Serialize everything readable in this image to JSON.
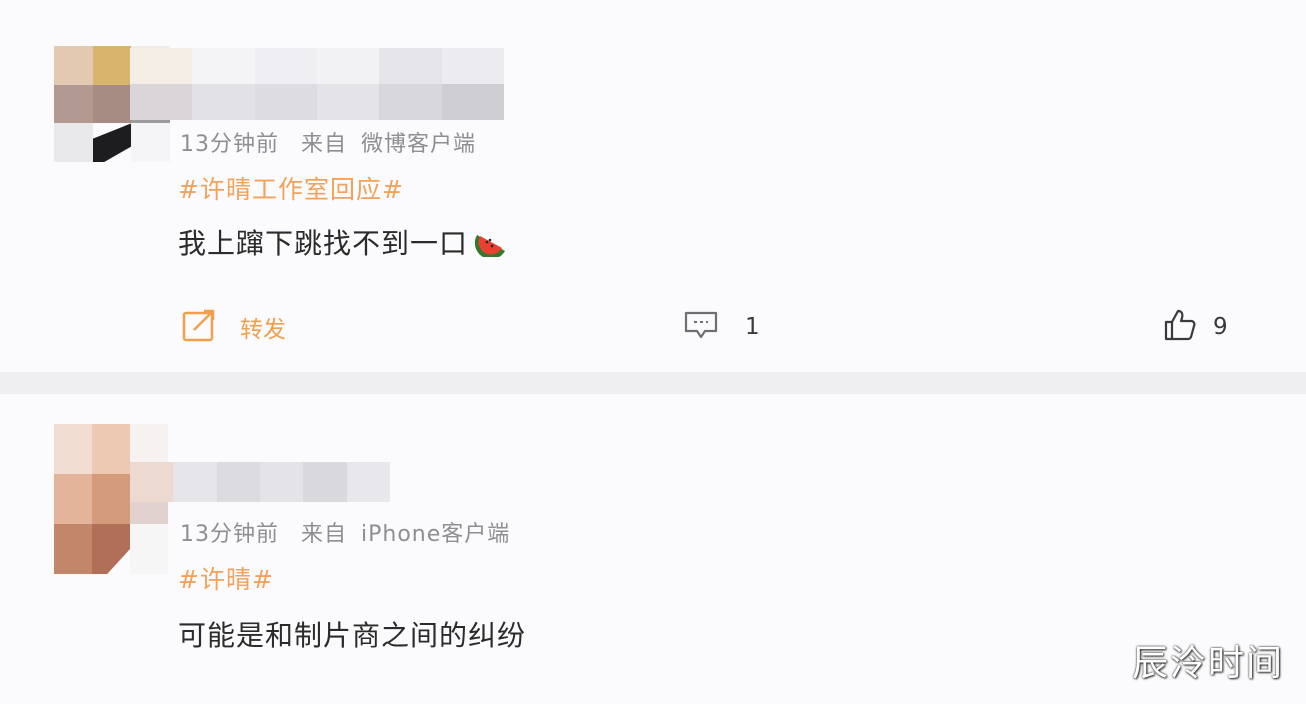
{
  "posts": [
    {
      "meta": {
        "time": "13分钟前",
        "source_prefix": "来自",
        "source": "微博客户端"
      },
      "hashtag": "#许晴工作室回应#",
      "content": "我上蹿下跳找不到一口",
      "emoji_name": "watermelon-icon",
      "repost_label": "转发",
      "comment_count": "1",
      "like_count": "9"
    },
    {
      "meta": {
        "time": "13分钟前",
        "source_prefix": "来自",
        "source": "iPhone客户端"
      },
      "hashtag": "#许晴#",
      "content": "可能是和制片商之间的纠纷"
    }
  ],
  "watermark": "辰泠时间",
  "colors": {
    "hashtag": "#f2a25a",
    "repost": "#f0a04b",
    "meta": "#8e8e93",
    "content": "#2b2b2b"
  },
  "icons": [
    "repost-icon",
    "comment-icon",
    "like-icon"
  ]
}
